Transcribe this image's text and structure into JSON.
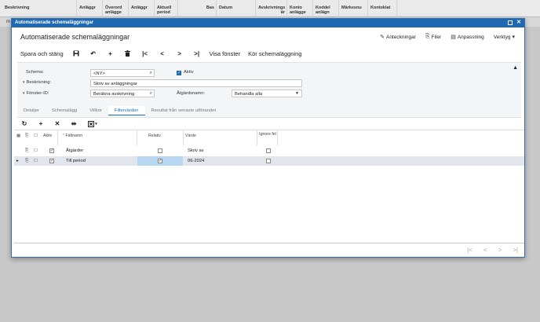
{
  "background": {
    "columns": [
      "Beskrivning",
      "Anläggr",
      "Överord anlägge",
      "Anläggr",
      "Aktuell period",
      "Bas",
      "Datum",
      "Avskrivnings år",
      "Konto anlägge",
      "Koddel anlägn",
      "Märkesnu",
      "Kontoklat"
    ],
    "row_fragment": "m"
  },
  "modal": {
    "window_title": "Automatiserade schemaläggningar",
    "page_title": "Automatiserade schemaläggningar",
    "header_actions": {
      "notes": "Anteckningar",
      "files": "Filer",
      "customize": "Anpassning",
      "tools": "Verktyg"
    },
    "toolbar": {
      "save_close": "Spara och stäng",
      "show_window": "Visa fönster",
      "run_schedule": "Kör schemaläggning"
    },
    "form": {
      "schema_label": "Schema:",
      "schema_value": "<NY>",
      "active_label": "Aktiv",
      "description_label": "Beskrivning:",
      "description_value": "Skriv av anläggningar",
      "screen_id_label": "Fönster-ID:",
      "screen_id_value": "Beräkna avskrivning",
      "action_name_label": "Åtgärdsnamn:",
      "action_name_value": "Behandla alla"
    },
    "tabs": [
      "Detaljer",
      "Schemalägg",
      "Villkor",
      "Filtervärden",
      "Resultat från senaste utförandet"
    ],
    "active_tab": 3,
    "grid": {
      "headers": {
        "active": "Aktiv",
        "field_name": "Fältnamn",
        "relative": "Relativ",
        "value": "Värde",
        "ignore_error": "Ignore fel"
      },
      "rows": [
        {
          "field_name": "Åtgärder",
          "value": "Skriv av",
          "active": true,
          "relative": false,
          "ignore": false,
          "selected": false
        },
        {
          "field_name": "Till period",
          "value": "06-2024",
          "active": true,
          "relative": true,
          "ignore": false,
          "selected": true
        }
      ]
    }
  },
  "colors": {
    "accent": "#1f69b3",
    "selected_row": "#e2e5ec",
    "cell_highlight": "#b7d6f2"
  }
}
